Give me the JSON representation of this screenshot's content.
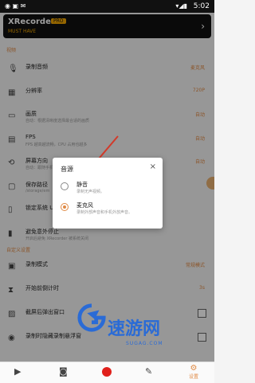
{
  "status": {
    "time": "5:02",
    "left": "◉ ▣ ✉",
    "signal": "▾◢▮"
  },
  "banner": {
    "logo": "XRecorder",
    "badge": "PRO",
    "tagline": "MUST HAVE",
    "chevron": "›"
  },
  "sections": {
    "video": "视频",
    "custom": "自定义设置"
  },
  "rows": [
    {
      "icon": "microphone-icon",
      "glyph": "🎙",
      "label": "录制音频",
      "value": "麦克风"
    },
    {
      "icon": "resolution-icon",
      "glyph": "▦",
      "label": "分辨率",
      "value": "720P"
    },
    {
      "icon": "quality-icon",
      "glyph": "▭",
      "label": "画质",
      "sub": "自动：根据清晰度选择最合适的画质",
      "value": "自动"
    },
    {
      "icon": "fps-icon",
      "glyph": "▤",
      "label": "FPS",
      "sub": "FPS 越高越流畅，CPU 占用也越多",
      "value": "自动"
    },
    {
      "icon": "orientation-icon",
      "glyph": "⟲",
      "label": "屏幕方向",
      "sub": "自动：跟随手机方向",
      "value": "自动"
    },
    {
      "icon": "save-path-icon",
      "glyph": "▢",
      "label": "保存路径",
      "sub": "/storage/em",
      "value": ""
    },
    {
      "icon": "system-ui-icon",
      "glyph": "▯",
      "label": "锁定系统 UI",
      "sub": "",
      "value": ""
    },
    {
      "icon": "avoid-stop-icon",
      "glyph": "▮",
      "label": "避免意外停止",
      "sub": "开启后避免 XRecorder 被系统关闭",
      "value": ""
    }
  ],
  "custom_rows": [
    {
      "icon": "record-mode-icon",
      "glyph": "▣",
      "label": "录制模式",
      "value": "常规模式"
    },
    {
      "icon": "countdown-icon",
      "glyph": "⧗",
      "label": "开始前倒计时",
      "value": "3s"
    },
    {
      "icon": "screenshot-window-icon",
      "glyph": "▨",
      "label": "截屏后弹出窗口",
      "value": ""
    },
    {
      "icon": "hide-recording-icon",
      "glyph": "◉",
      "label": "录制时隐藏录制悬浮窗",
      "value": ""
    }
  ],
  "dialog": {
    "title": "音源",
    "close": "×",
    "options": [
      {
        "label": "静音",
        "desc": "录制无声视频。",
        "selected": false
      },
      {
        "label": "麦克风",
        "desc": "录制外部声音和手机外放声音。",
        "selected": true
      }
    ]
  },
  "bottombar": {
    "settings_label": "设置"
  },
  "watermark": {
    "text": "速游网",
    "sub": "SUGAG.COM"
  },
  "colors": {
    "accent": "#e08a45",
    "record": "#e0201b"
  }
}
